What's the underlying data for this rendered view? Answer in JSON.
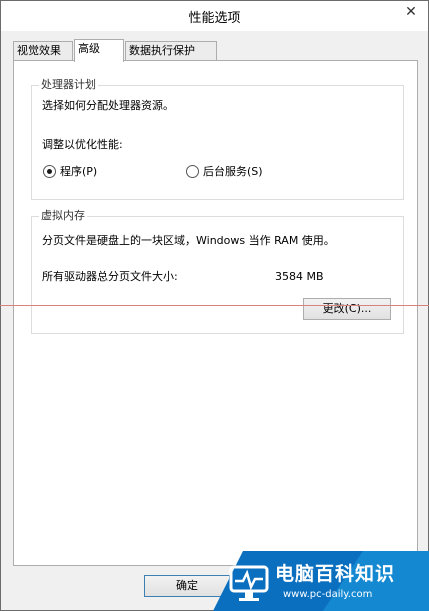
{
  "window": {
    "title": "性能选项",
    "close_glyph": "✕"
  },
  "tabs": [
    {
      "label": "视觉效果"
    },
    {
      "label": "高级"
    },
    {
      "label": "数据执行保护"
    }
  ],
  "processor": {
    "group_title": "处理器计划",
    "description": "选择如何分配处理器资源。",
    "adjust_label": "调整以优化性能:",
    "option_programs": "程序(P)",
    "option_background": "后台服务(S)",
    "selected": "程序(P)"
  },
  "virtual_memory": {
    "group_title": "虚拟内存",
    "description": "分页文件是硬盘上的一块区域，Windows 当作 RAM 使用。",
    "total_label": "所有驱动器总分页文件大小:",
    "total_value": "3584 MB",
    "change_button": "更改(C)..."
  },
  "footer": {
    "ok_button": "确定"
  },
  "watermark": {
    "site_name": "电脑百科知识",
    "url": "www.pc-daily.com",
    "colors": {
      "primary": "#0a6fbf",
      "accent": "#1d9fe0"
    }
  },
  "colors": {
    "annotation_line": "#d98080"
  }
}
